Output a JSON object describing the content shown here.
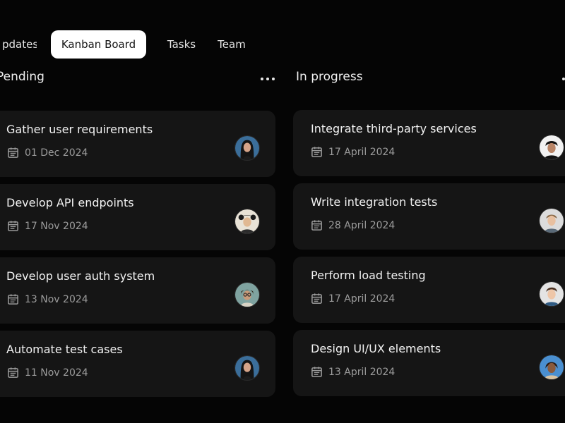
{
  "tabs": [
    {
      "label": "Updates"
    },
    {
      "label": "Kanban Board"
    },
    {
      "label": "Tasks"
    },
    {
      "label": "Team"
    }
  ],
  "columns": [
    {
      "title": "Pending",
      "cards": [
        {
          "title": "Gather user requirements",
          "date": "01 Dec 2024"
        },
        {
          "title": "Develop API endpoints",
          "date": "17 Nov 2024"
        },
        {
          "title": "Develop user auth system",
          "date": "13 Nov 2024"
        },
        {
          "title": "Automate test cases",
          "date": "11 Nov 2024"
        }
      ]
    },
    {
      "title": "In progress",
      "cards": [
        {
          "title": "Integrate third-party services",
          "date": "17 April 2024"
        },
        {
          "title": "Write integration tests",
          "date": "28 April 2024"
        },
        {
          "title": "Perform load testing",
          "date": "17 April 2024"
        },
        {
          "title": "Design UI/UX elements",
          "date": "13 April 2024"
        }
      ]
    }
  ],
  "icons": {
    "more": "more-horizontal-icon",
    "date": "calendar-icon"
  },
  "colors": {
    "background": "#050505",
    "card": "#151515",
    "active_tab": "#ffffff",
    "muted_text": "#9c9c9c"
  }
}
